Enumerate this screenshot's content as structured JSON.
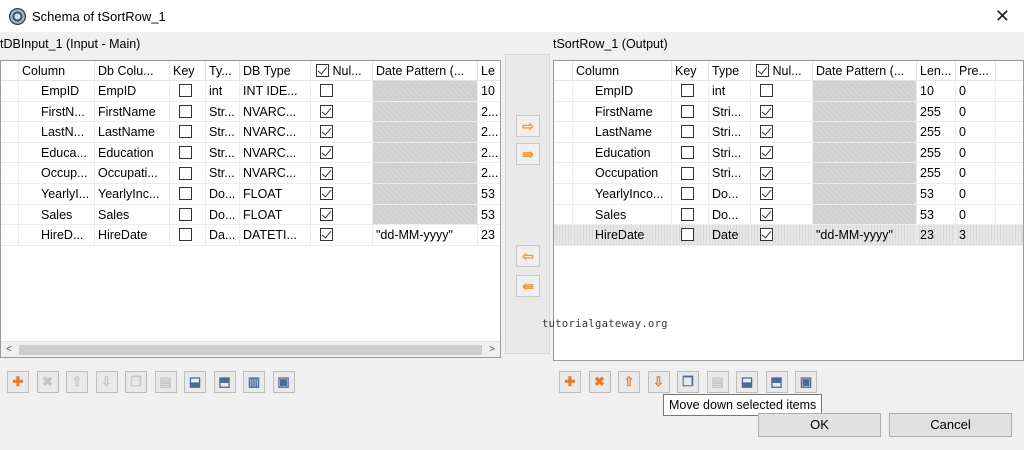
{
  "window": {
    "title": "Schema of tSortRow_1",
    "close_glyph": "✕"
  },
  "input": {
    "label": "tDBInput_1 (Input - Main)",
    "columns": [
      "Column",
      "Db Colu...",
      "Key",
      "Ty...",
      "DB Type",
      "Nul...",
      "Date Pattern (...",
      "Le"
    ],
    "rows": [
      {
        "column": "EmpID",
        "db_column": "EmpID",
        "key": false,
        "type": "int",
        "db_type": "INT IDE...",
        "nullable": false,
        "date_pattern": "",
        "length": "10"
      },
      {
        "column": "FirstN...",
        "db_column": "FirstName",
        "key": false,
        "type": "Str...",
        "db_type": "NVARC...",
        "nullable": true,
        "date_pattern": "",
        "length": "2..."
      },
      {
        "column": "LastN...",
        "db_column": "LastName",
        "key": false,
        "type": "Str...",
        "db_type": "NVARC...",
        "nullable": true,
        "date_pattern": "",
        "length": "2..."
      },
      {
        "column": "Educa...",
        "db_column": "Education",
        "key": false,
        "type": "Str...",
        "db_type": "NVARC...",
        "nullable": true,
        "date_pattern": "",
        "length": "2..."
      },
      {
        "column": "Occup...",
        "db_column": "Occupati...",
        "key": false,
        "type": "Str...",
        "db_type": "NVARC...",
        "nullable": true,
        "date_pattern": "",
        "length": "2..."
      },
      {
        "column": "YearlyI...",
        "db_column": "YearlyInc...",
        "key": false,
        "type": "Do...",
        "db_type": "FLOAT",
        "nullable": true,
        "date_pattern": "",
        "length": "53"
      },
      {
        "column": "Sales",
        "db_column": "Sales",
        "key": false,
        "type": "Do...",
        "db_type": "FLOAT",
        "nullable": true,
        "date_pattern": "",
        "length": "53"
      },
      {
        "column": "HireD...",
        "db_column": "HireDate",
        "key": false,
        "type": "Da...",
        "db_type": "DATETI...",
        "nullable": true,
        "date_pattern": "\"dd-MM-yyyy\"",
        "length": "23"
      }
    ]
  },
  "output": {
    "label": "tSortRow_1 (Output)",
    "columns": [
      "Column",
      "Key",
      "Type",
      "Nul...",
      "Date Pattern (...",
      "Len...",
      "Pre..."
    ],
    "rows": [
      {
        "column": "EmpID",
        "key": false,
        "type": "int",
        "nullable": false,
        "date_pattern": "",
        "length": "10",
        "precision": "0"
      },
      {
        "column": "FirstName",
        "key": false,
        "type": "Stri...",
        "nullable": true,
        "date_pattern": "",
        "length": "255",
        "precision": "0"
      },
      {
        "column": "LastName",
        "key": false,
        "type": "Stri...",
        "nullable": true,
        "date_pattern": "",
        "length": "255",
        "precision": "0"
      },
      {
        "column": "Education",
        "key": false,
        "type": "Stri...",
        "nullable": true,
        "date_pattern": "",
        "length": "255",
        "precision": "0"
      },
      {
        "column": "Occupation",
        "key": false,
        "type": "Stri...",
        "nullable": true,
        "date_pattern": "",
        "length": "255",
        "precision": "0"
      },
      {
        "column": "YearlyInco...",
        "key": false,
        "type": "Do...",
        "nullable": true,
        "date_pattern": "",
        "length": "53",
        "precision": "0"
      },
      {
        "column": "Sales",
        "key": false,
        "type": "Do...",
        "nullable": true,
        "date_pattern": "",
        "length": "53",
        "precision": "0"
      },
      {
        "column": "HireDate",
        "key": false,
        "type": "Date",
        "nullable": true,
        "date_pattern": "\"dd-MM-yyyy\"",
        "length": "23",
        "precision": "3",
        "selected": true
      }
    ]
  },
  "middle_buttons": [
    {
      "name": "copy-all-right-button",
      "glyph": "⇨"
    },
    {
      "name": "copy-selected-right-button",
      "glyph": "⇛"
    },
    {
      "name": "copy-all-left-button",
      "glyph": "⇦"
    },
    {
      "name": "copy-selected-left-button",
      "glyph": "⇚"
    }
  ],
  "watermark": "tutorialgateway.org",
  "tooltip": "Move down selected items",
  "buttons": {
    "ok": "OK",
    "cancel": "Cancel"
  },
  "colors": {
    "accent_orange": "#e07b2c",
    "selected_row": "#e6e6e6",
    "disabled_cell": "#cfcfcf"
  }
}
